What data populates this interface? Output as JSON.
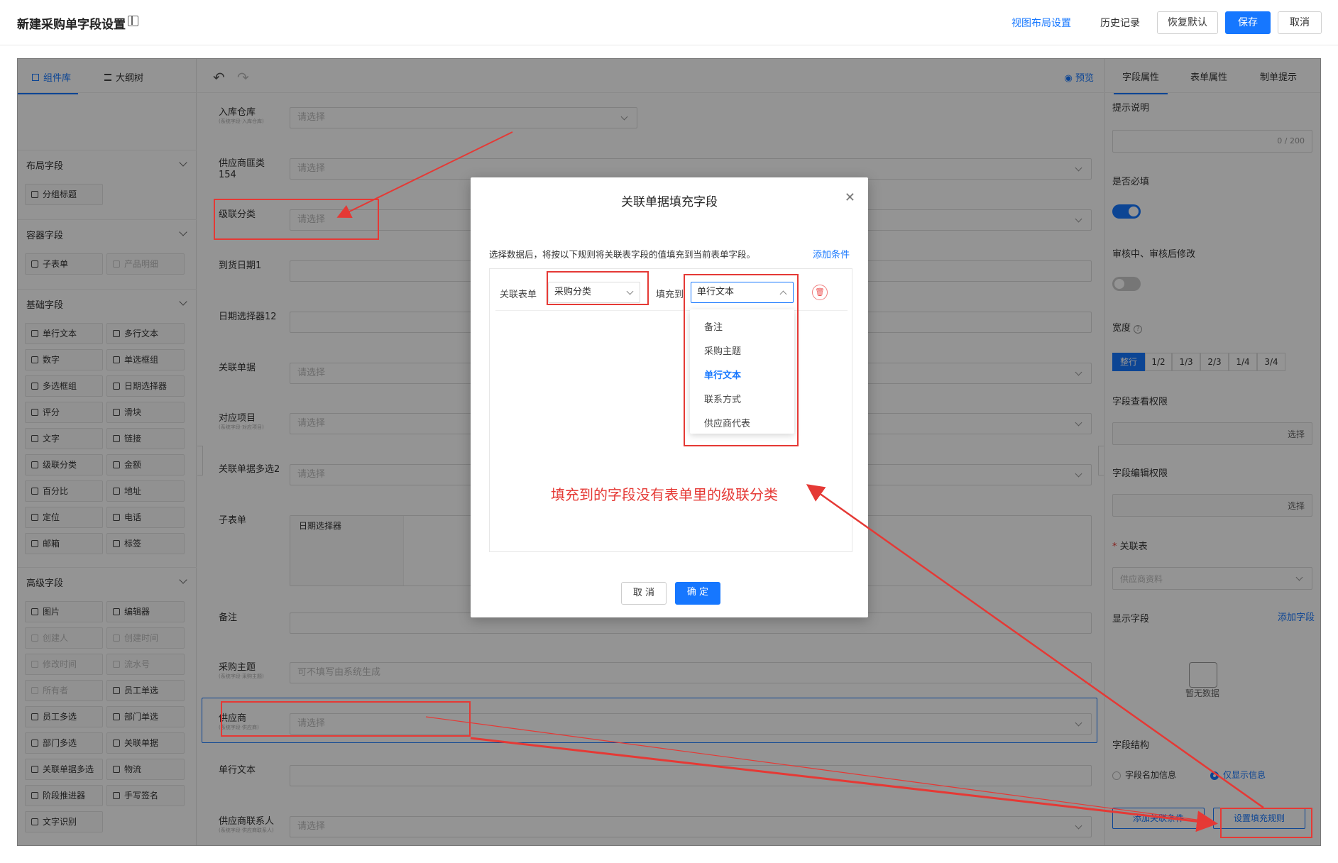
{
  "topbar": {
    "title": "新建采购单字段设置",
    "view_layout": "视图布局设置",
    "history": "历史记录",
    "restore": "恢复默认",
    "save": "保存",
    "cancel": "取消"
  },
  "left": {
    "tabs": [
      "组件库",
      "大纲树"
    ],
    "sections": [
      {
        "title": "布局字段",
        "items": [
          "分组标题"
        ]
      },
      {
        "title": "容器字段",
        "items": [
          "子表单",
          "产品明细"
        ]
      },
      {
        "title": "基础字段",
        "items": [
          "单行文本",
          "多行文本",
          "数字",
          "单选框组",
          "多选框组",
          "日期选择器",
          "评分",
          "滑块",
          "文字",
          "链接",
          "级联分类",
          "金额",
          "百分比",
          "地址",
          "定位",
          "电话",
          "邮箱",
          "标签"
        ]
      },
      {
        "title": "高级字段",
        "items": [
          "图片",
          "编辑器",
          "创建人",
          "创建时间",
          "修改时间",
          "流水号",
          "所有者",
          "员工单选",
          "员工多选",
          "部门单选",
          "部门多选",
          "关联单据",
          "关联单据多选",
          "物流",
          "阶段推进器",
          "手写签名",
          "文字识别"
        ]
      }
    ]
  },
  "center": {
    "preview": "预览",
    "fields": [
      {
        "label": "入库仓库",
        "sub": "(系统字段·入库仓库)",
        "placeholder": "请选择"
      },
      {
        "label": "供应商匪类154",
        "sub": "",
        "placeholder": "请选择"
      },
      {
        "label": "级联分类",
        "sub": "",
        "placeholder": "请选择"
      },
      {
        "label": "到货日期1",
        "sub": "",
        "placeholder": ""
      },
      {
        "label": "日期选择器12",
        "sub": "",
        "placeholder": ""
      },
      {
        "label": "关联单据",
        "sub": "",
        "placeholder": "请选择"
      },
      {
        "label": "对应项目",
        "sub": "(系统字段·对应项目)",
        "placeholder": "请选择"
      },
      {
        "label": "关联单据多选2",
        "sub": "",
        "placeholder": "请选择"
      },
      {
        "label": "子表单",
        "sub": "",
        "placeholder": ""
      },
      {
        "label": "备注",
        "sub": "",
        "placeholder": ""
      },
      {
        "label": "采购主题",
        "sub": "(系统字段·采购主题)",
        "placeholder": "可不填写由系统生成"
      },
      {
        "label": "供应商",
        "sub": "(系统字段·供应商)",
        "placeholder": "请选择"
      },
      {
        "label": "单行文本",
        "sub": "",
        "placeholder": ""
      },
      {
        "label": "供应商联系人",
        "sub": "(系统字段·供应商联系人)",
        "placeholder": "请选择"
      }
    ],
    "subform_col": "日期选择器"
  },
  "right": {
    "tabs": [
      "字段属性",
      "表单属性",
      "制单提示"
    ],
    "hint_label": "提示说明",
    "hint_count": "0 / 200",
    "required_label": "是否必填",
    "required_on": true,
    "modify_label": "审核中、审核后修改",
    "modify_on": false,
    "width_label": "宽度",
    "width_options": [
      "整行",
      "1/2",
      "1/3",
      "2/3",
      "1/4",
      "3/4"
    ],
    "width_selected": "整行",
    "view_perm_label": "字段查看权限",
    "edit_perm_label": "字段编辑权限",
    "select_btn": "选择",
    "relate_label": "关联表",
    "relate_value": "供应商资料",
    "display_label": "显示字段",
    "add_field": "添加字段",
    "empty_text": "暂无数据",
    "structure_label": "字段结构",
    "struct_opt1": "字段名加信息",
    "struct_opt2": "仅显示信息",
    "add_relate_cond": "添加关联条件",
    "set_fill_rule": "设置填充规则"
  },
  "modal": {
    "title": "关联单据填充字段",
    "desc": "选择数据后，将按以下规则将关联表字段的值填充到当前表单字段。",
    "add_condition": "添加条件",
    "relate_form_label": "关联表单",
    "relate_form_value": "采购分类",
    "fill_to_label": "填充到",
    "fill_to_value": "单行文本",
    "dropdown_options": [
      "备注",
      "采购主题",
      "单行文本",
      "联系方式",
      "供应商代表"
    ],
    "dropdown_selected": "单行文本",
    "cancel": "取 消",
    "confirm": "确 定"
  },
  "annotation": {
    "note": "填充到的字段没有表单里的级联分类",
    "color": "#e53935"
  },
  "colors": {
    "accent": "#1677ff",
    "annotation": "#e53935"
  }
}
